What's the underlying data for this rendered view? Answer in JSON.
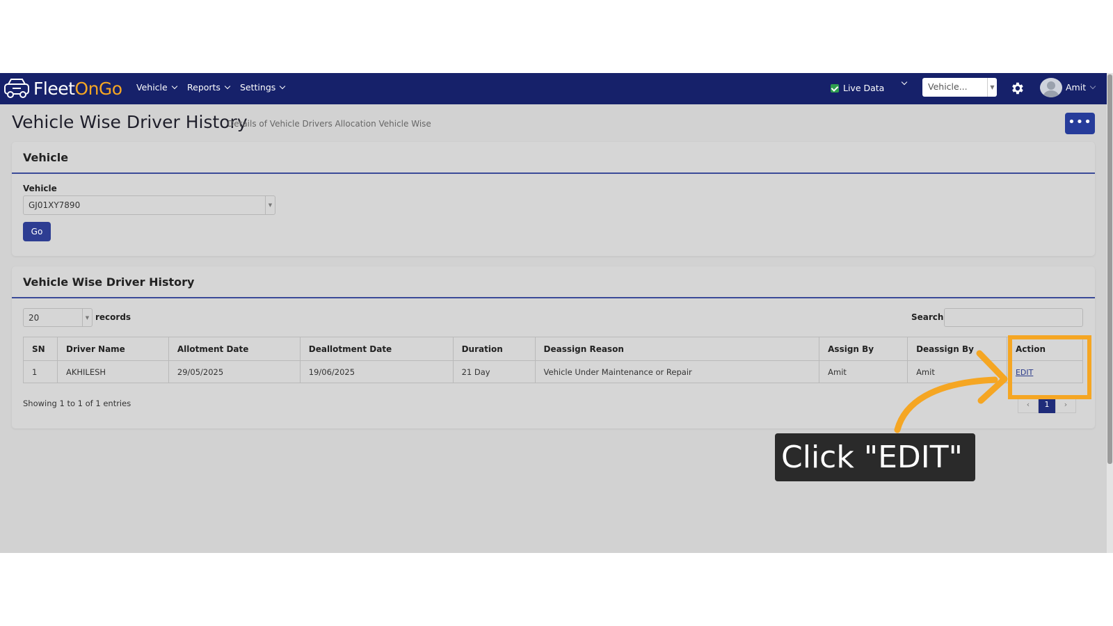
{
  "app": {
    "logo_part1": "Fleet",
    "logo_part2": "OnGo",
    "nav": [
      "Vehicle",
      "Reports",
      "Settings"
    ],
    "live_data_label": "Live Data",
    "vehicle_select": "Vehicle...",
    "user_name": "Amit"
  },
  "page": {
    "title": "Vehicle Wise Driver History",
    "subtitle": "Details of Vehicle Drivers Allocation Vehicle Wise",
    "more_button": "•••"
  },
  "filter_card": {
    "title": "Vehicle",
    "field_label": "Vehicle",
    "field_value": "GJ01XY7890",
    "go_button": "Go"
  },
  "history_card": {
    "title": "Vehicle Wise Driver History",
    "records_value": "20",
    "records_label": "records",
    "search_label": "Search:",
    "columns": [
      "SN",
      "Driver Name",
      "Allotment Date",
      "Deallotment Date",
      "Duration",
      "Deassign Reason",
      "Assign By",
      "Deassign By",
      "Action"
    ],
    "rows": [
      [
        "1",
        "AKHILESH",
        "29/05/2025",
        "19/06/2025",
        "21 Day",
        "Vehicle Under Maintenance or Repair",
        "Amit",
        "Amit",
        "EDIT"
      ]
    ],
    "showing": "Showing 1 to 1 of 1 entries",
    "pagination": [
      "‹",
      "1",
      "›"
    ]
  },
  "annotation": {
    "callout": "Click \"EDIT\"",
    "color": "#f5a623"
  },
  "colors": {
    "navbar": "#16216a",
    "primary_button": "#2d3d92",
    "accent": "#f5a623"
  }
}
